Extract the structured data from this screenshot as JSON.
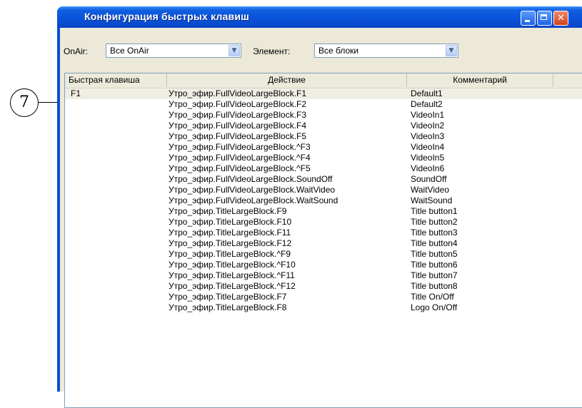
{
  "callout": {
    "number": "7"
  },
  "window": {
    "title": "Конфигурация быстрых клавиш"
  },
  "filters": {
    "onair_label": "OnAir:",
    "onair_value": "Все OnAir",
    "element_label": "Элемент:",
    "element_value": "Все блоки"
  },
  "table": {
    "columns": [
      "Быстрая клавиша",
      "Действие",
      "Комментарий"
    ],
    "rows": [
      {
        "key": "F1",
        "action": "Утро_эфир.FullVideoLargeBlock.F1",
        "comment": "Default1"
      },
      {
        "key": "",
        "action": "Утро_эфир.FullVideoLargeBlock.F2",
        "comment": "Default2"
      },
      {
        "key": "",
        "action": "Утро_эфир.FullVideoLargeBlock.F3",
        "comment": "VideoIn1"
      },
      {
        "key": "",
        "action": "Утро_эфир.FullVideoLargeBlock.F4",
        "comment": "VideoIn2"
      },
      {
        "key": "",
        "action": "Утро_эфир.FullVideoLargeBlock.F5",
        "comment": "VideoIn3"
      },
      {
        "key": "",
        "action": "Утро_эфир.FullVideoLargeBlock.^F3",
        "comment": "VideoIn4"
      },
      {
        "key": "",
        "action": "Утро_эфир.FullVideoLargeBlock.^F4",
        "comment": "VideoIn5"
      },
      {
        "key": "",
        "action": "Утро_эфир.FullVideoLargeBlock.^F5",
        "comment": "VideoIn6"
      },
      {
        "key": "",
        "action": "Утро_эфир.FullVideoLargeBlock.SoundOff",
        "comment": "SoundOff"
      },
      {
        "key": "",
        "action": "Утро_эфир.FullVideoLargeBlock.WaitVideo",
        "comment": "WaitVideo"
      },
      {
        "key": "",
        "action": "Утро_эфир.FullVideoLargeBlock.WaitSound",
        "comment": "WaitSound"
      },
      {
        "key": "",
        "action": "Утро_эфир.TitleLargeBlock.F9",
        "comment": "Title button1"
      },
      {
        "key": "",
        "action": "Утро_эфир.TitleLargeBlock.F10",
        "comment": "Title button2"
      },
      {
        "key": "",
        "action": "Утро_эфир.TitleLargeBlock.F11",
        "comment": "Title button3"
      },
      {
        "key": "",
        "action": "Утро_эфир.TitleLargeBlock.F12",
        "comment": "Title button4"
      },
      {
        "key": "",
        "action": "Утро_эфир.TitleLargeBlock.^F9",
        "comment": "Title button5"
      },
      {
        "key": "",
        "action": "Утро_эфир.TitleLargeBlock.^F10",
        "comment": "Title button6"
      },
      {
        "key": "",
        "action": "Утро_эфир.TitleLargeBlock.^F11",
        "comment": "Title button7"
      },
      {
        "key": "",
        "action": "Утро_эфир.TitleLargeBlock.^F12",
        "comment": "Title button8"
      },
      {
        "key": "",
        "action": "Утро_эфир.TitleLargeBlock.F7",
        "comment": "Title On/Off"
      },
      {
        "key": "",
        "action": "Утро_эфир.TitleLargeBlock.F8",
        "comment": "Logo On/Off"
      }
    ]
  }
}
